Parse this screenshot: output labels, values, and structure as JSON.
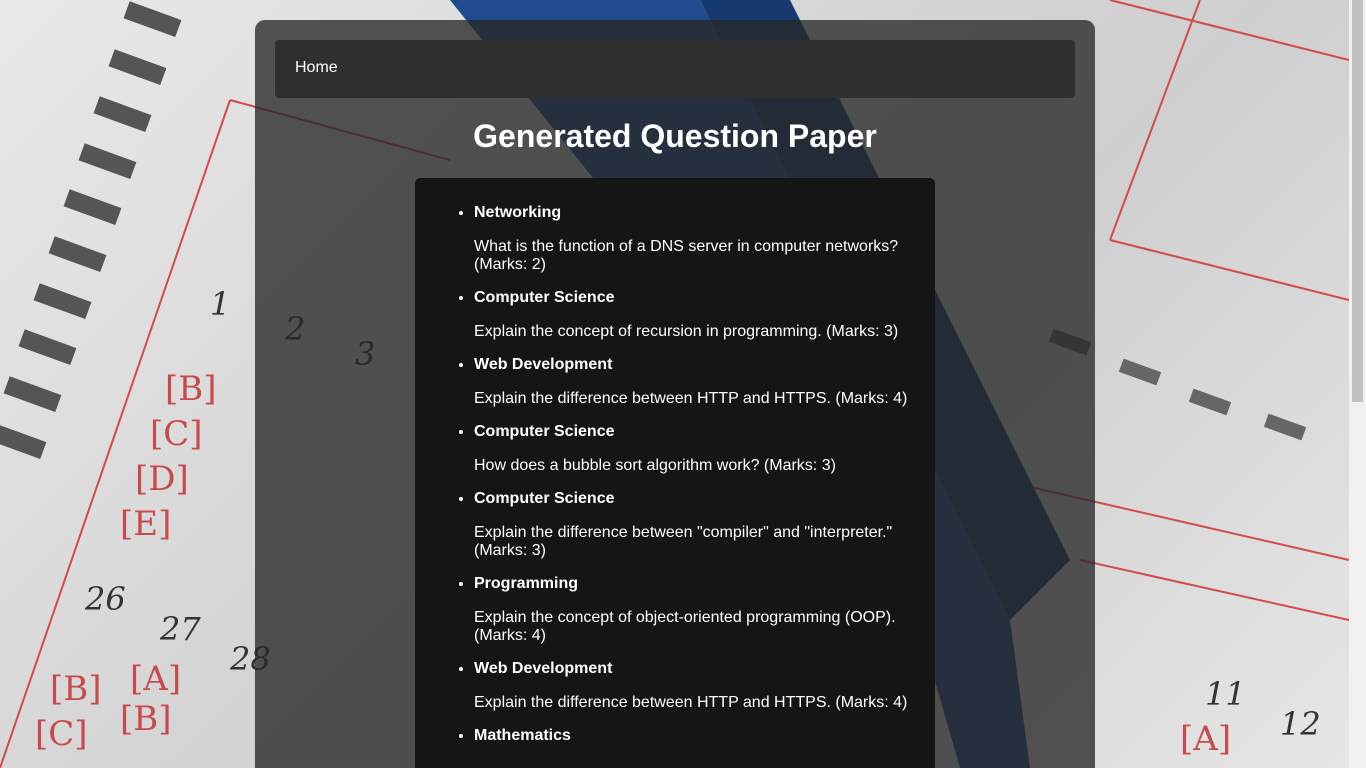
{
  "nav": {
    "home_label": "Home"
  },
  "page": {
    "title": "Generated Question Paper"
  },
  "questions": [
    {
      "subject": "Networking",
      "text": "What is the function of a DNS server in computer networks? (Marks: 2)"
    },
    {
      "subject": "Computer Science",
      "text": "Explain the concept of recursion in programming. (Marks: 3)"
    },
    {
      "subject": "Web Development",
      "text": "Explain the difference between HTTP and HTTPS. (Marks: 4)"
    },
    {
      "subject": "Computer Science",
      "text": "How does a bubble sort algorithm work? (Marks: 3)"
    },
    {
      "subject": "Computer Science",
      "text": "Explain the difference between \"compiler\" and \"interpreter.\" (Marks: 3)"
    },
    {
      "subject": "Programming",
      "text": "Explain the concept of object-oriented programming (OOP). (Marks: 4)"
    },
    {
      "subject": "Web Development",
      "text": "Explain the difference between HTTP and HTTPS. (Marks: 4)"
    },
    {
      "subject": "Mathematics",
      "text": ""
    }
  ],
  "colors": {
    "panel": "#282828",
    "navbar": "#2f2f2f",
    "question_box": "#151515",
    "text": "#ffffff"
  }
}
